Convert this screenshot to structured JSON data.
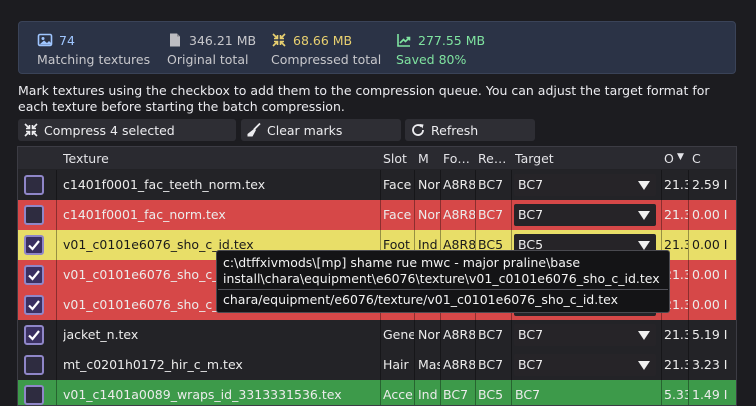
{
  "stats": {
    "matching": {
      "value": "74",
      "label": "Matching textures",
      "color": "#9fc6ff"
    },
    "original": {
      "value": "346.21 MB",
      "label": "Original total",
      "color": "#c8c8cc"
    },
    "compressed": {
      "value": "68.66 MB",
      "label": "Compressed total",
      "color": "#e8d070"
    },
    "saved": {
      "value": "277.55 MB",
      "label": "Saved 80%",
      "color": "#7fe3a0"
    }
  },
  "description": "Mark textures using the checkbox to add them to the compression queue. You can adjust the target format for each texture before starting the batch compression.",
  "toolbar": {
    "compress_label": "Compress 4 selected",
    "clear_label": "Clear marks",
    "refresh_label": "Refresh"
  },
  "table": {
    "columns": [
      "Texture",
      "Slot",
      "M",
      "Fo…",
      "Re…",
      "Target",
      "O",
      "C"
    ],
    "sort_indicator": "▼",
    "rows": [
      {
        "checked": false,
        "texture": "c1401f0001_fac_teeth_norm.tex",
        "slot": "Face",
        "m": "Nor",
        "format": "A8R8",
        "re": "BC7",
        "target": "BC7",
        "o": "21.3",
        "c": "2.59 I",
        "bg": "#232327",
        "color": "#ececec",
        "dropdown": true
      },
      {
        "checked": false,
        "texture": "c1401f0001_fac_norm.tex",
        "slot": "Face",
        "m": "Nor",
        "format": "A8R8",
        "re": "BC7",
        "target": "BC7",
        "o": "21.3",
        "c": "0.00 I",
        "bg": "#d64848",
        "color": "#ececec",
        "dropdown": true
      },
      {
        "checked": true,
        "texture": "v01_c0101e6076_sho_c_id.tex",
        "slot": "Foot",
        "m": "Ind",
        "format": "A8R8",
        "re": "BC5",
        "target": "BC5",
        "o": "21.3",
        "c": "0.00 I",
        "bg": "#e8de68",
        "color": "#1a1a1a",
        "dropdown": true
      },
      {
        "checked": true,
        "texture": "v01_c0101e6076_sho_c_id.tex",
        "slot": "Foot",
        "m": "Ind",
        "format": "A8R8",
        "re": "BC5",
        "target": "BC5",
        "o": "21.3",
        "c": "0.00 I",
        "bg": "#d64848",
        "color": "#ececec",
        "dropdown": true
      },
      {
        "checked": true,
        "texture": "v01_c0101e6076_sho_c_id.tex",
        "slot": "Foot",
        "m": "Ind",
        "format": "A8R8",
        "re": "BC5",
        "target": "BC5",
        "o": "21.3",
        "c": "0.00 I",
        "bg": "#d64848",
        "color": "#ececec",
        "dropdown": true
      },
      {
        "checked": true,
        "texture": "jacket_n.tex",
        "slot": "Gene",
        "m": "Nor",
        "format": "A8R8",
        "re": "BC7",
        "target": "BC7",
        "o": "21.3",
        "c": "5.19 I",
        "bg": "#232327",
        "color": "#ececec",
        "dropdown": true
      },
      {
        "checked": false,
        "texture": "mt_c0201h0172_hir_c_m.tex",
        "slot": "Hair",
        "m": "Mas",
        "format": "A8R8",
        "re": "BC7",
        "target": "BC7",
        "o": "21.3",
        "c": "3.23 I",
        "bg": "#232327",
        "color": "#ececec",
        "dropdown": true
      },
      {
        "checked": false,
        "texture": "v01_c1401a0089_wraps_id_3313331536.tex",
        "slot": "Acce",
        "m": "Ind",
        "format": "BC7",
        "re": "BC5",
        "target": "BC7",
        "o": "5.33",
        "c": "1.49 I",
        "bg": "#3d9a4a",
        "color": "#ececec",
        "dropdown": false
      }
    ]
  },
  "tooltip": {
    "path_full": "c:\\dtffxivmods\\[mp] shame rue mwc - major praline\\base install\\chara\\equipment\\e6076\\texture\\v01_c0101e6076_sho_c_id.tex",
    "path_game": "chara/equipment/e6076/texture/v01_c0101e6076_sho_c_id.tex"
  },
  "icons": {
    "matching": "image-icon",
    "original": "file-icon",
    "compressed": "compress-icon",
    "saved": "trend-up-icon",
    "compress_button": "compress-icon",
    "clear_button": "broom-icon",
    "refresh_button": "refresh-icon"
  }
}
